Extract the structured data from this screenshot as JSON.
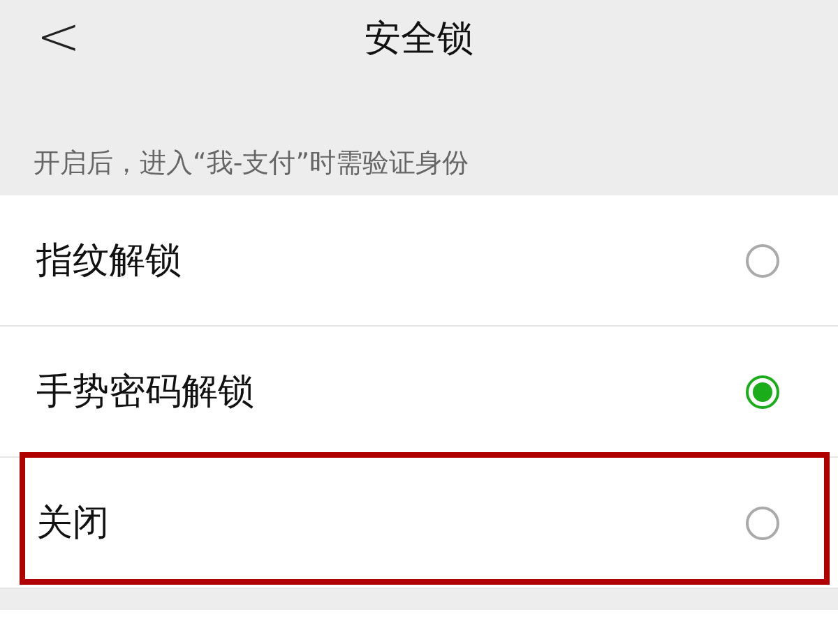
{
  "header": {
    "back": "<",
    "title": "安全锁"
  },
  "note": "开启后，进入“我-支付”时需验证身份",
  "options": [
    {
      "label": "指纹解锁",
      "selected": false,
      "highlighted": false
    },
    {
      "label": "手势密码解锁",
      "selected": true,
      "highlighted": false
    },
    {
      "label": "关闭",
      "selected": false,
      "highlighted": true
    }
  ]
}
